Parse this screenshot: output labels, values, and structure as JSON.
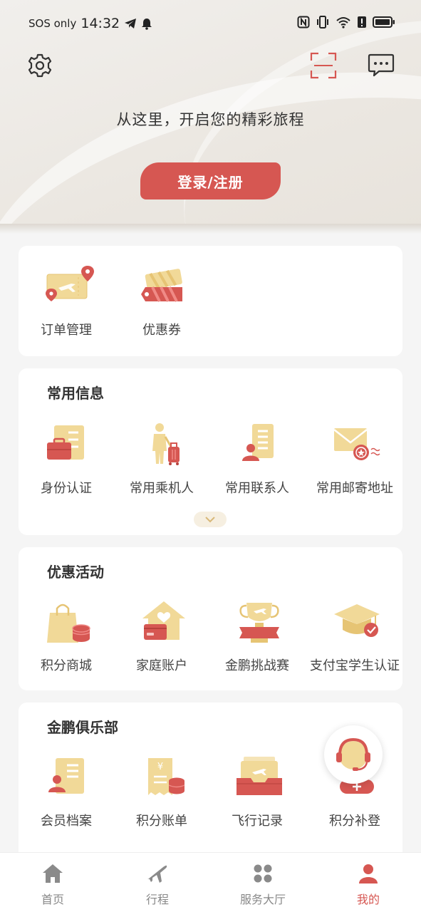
{
  "status_bar": {
    "carrier": "SOS only",
    "time": "14:32"
  },
  "header": {
    "slogan": "从这里，开启您的精彩旅程",
    "login_label": "登录/注册"
  },
  "quick_links": [
    {
      "label": "订单管理",
      "icon": "order-ticket-icon"
    },
    {
      "label": "优惠券",
      "icon": "coupon-icon"
    }
  ],
  "common_info": {
    "title": "常用信息",
    "items": [
      {
        "label": "身份认证",
        "icon": "id-card-icon"
      },
      {
        "label": "常用乘机人",
        "icon": "passenger-icon"
      },
      {
        "label": "常用联系人",
        "icon": "contact-icon"
      },
      {
        "label": "常用邮寄地址",
        "icon": "mail-address-icon"
      }
    ]
  },
  "promotions": {
    "title": "优惠活动",
    "items": [
      {
        "label": "积分商城",
        "icon": "points-mall-icon"
      },
      {
        "label": "家庭账户",
        "icon": "family-account-icon"
      },
      {
        "label": "金鹏挑战赛",
        "icon": "challenge-trophy-icon"
      },
      {
        "label": "支付宝学生认证",
        "icon": "student-cap-icon"
      }
    ]
  },
  "club": {
    "title": "金鹏俱乐部",
    "items": [
      {
        "label": "会员档案",
        "icon": "member-profile-icon"
      },
      {
        "label": "积分账单",
        "icon": "points-bill-icon"
      },
      {
        "label": "飞行记录",
        "icon": "flight-record-icon"
      },
      {
        "label": "积分补登",
        "icon": "points-claim-icon"
      }
    ]
  },
  "bottom_nav": [
    {
      "label": "首页",
      "icon": "home-icon"
    },
    {
      "label": "行程",
      "icon": "plane-icon"
    },
    {
      "label": "服务大厅",
      "icon": "services-grid-icon"
    },
    {
      "label": "我的",
      "icon": "profile-icon",
      "active": true
    }
  ],
  "colors": {
    "accent": "#d65752",
    "gold": "#e8c97a",
    "background": "#f5f5f5"
  }
}
